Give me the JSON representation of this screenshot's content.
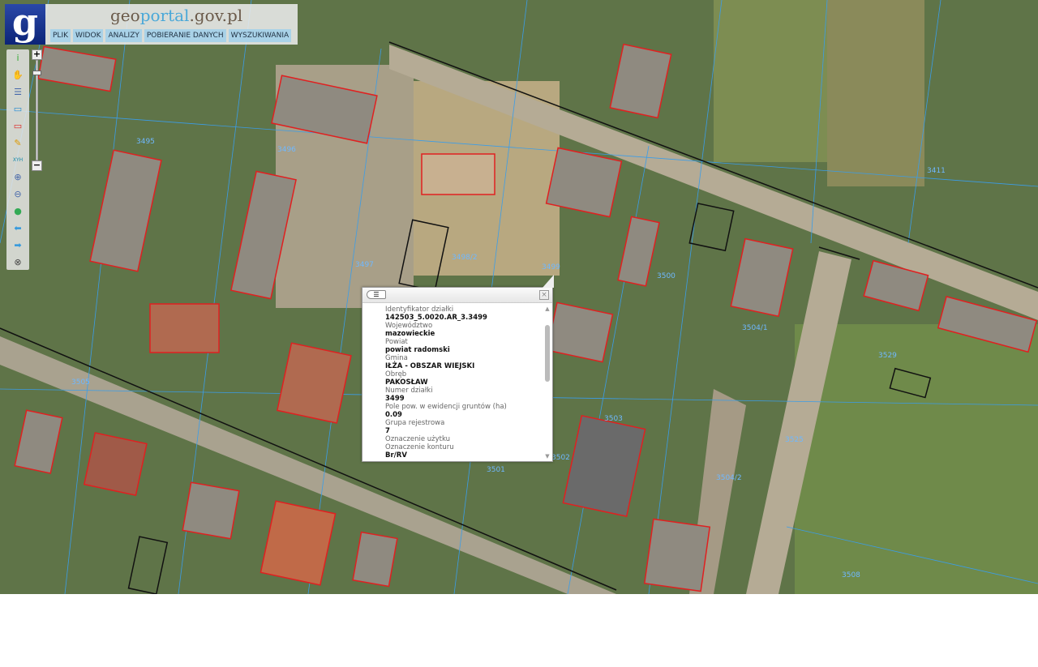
{
  "header": {
    "logo_letter": "g",
    "site_title_a": "geo",
    "site_title_b": "portal",
    "site_title_c": ".gov.pl",
    "menu": [
      "PLIK",
      "WIDOK",
      "ANALIZY",
      "POBIERANIE DANYCH",
      "WYSZUKIWANIA"
    ]
  },
  "toolbar": {
    "tools": [
      {
        "name": "info-icon",
        "glyph": "i",
        "color": "#3a3"
      },
      {
        "name": "pan-hand-icon",
        "glyph": "✋",
        "color": "#c96"
      },
      {
        "name": "legend-icon",
        "glyph": "☰",
        "color": "#46a"
      },
      {
        "name": "select-blue-icon",
        "glyph": "▭",
        "color": "#28c"
      },
      {
        "name": "select-red-icon",
        "glyph": "▭",
        "color": "#d22"
      },
      {
        "name": "pencil-icon",
        "glyph": "✎",
        "color": "#d90"
      },
      {
        "name": "xyh-icon",
        "glyph": "XYH",
        "color": "#18a"
      },
      {
        "name": "zoom-in-icon",
        "glyph": "⊕",
        "color": "#46a"
      },
      {
        "name": "zoom-out-icon",
        "glyph": "⊖",
        "color": "#46a"
      },
      {
        "name": "globe-icon",
        "glyph": "●",
        "color": "#3a5"
      },
      {
        "name": "back-arrow-icon",
        "glyph": "⬅",
        "color": "#39d"
      },
      {
        "name": "forward-arrow-icon",
        "glyph": "➡",
        "color": "#39d"
      },
      {
        "name": "full-extent-icon",
        "glyph": "⊗",
        "color": "#444"
      }
    ],
    "zoom_in": "+",
    "zoom_out": "−",
    "zoom_level": 0.1
  },
  "map": {
    "parcel_labels": [
      "3495",
      "3496",
      "3497",
      "3498/2",
      "3499",
      "3500",
      "3501",
      "3502",
      "3503",
      "3504/1",
      "3504/2",
      "3505",
      "3525",
      "3529",
      "3411",
      "3508"
    ]
  },
  "popup": {
    "back": "☰",
    "close": "×",
    "fields": [
      {
        "label": "Identyfikator działki",
        "value": "142503_5.0020.AR_3.3499"
      },
      {
        "label": "Województwo",
        "value": "mazowieckie"
      },
      {
        "label": "Powiat",
        "value": "powiat radomski"
      },
      {
        "label": "Gmina",
        "value": "IŁŻA - OBSZAR WIEJSKI"
      },
      {
        "label": "Obręb",
        "value": "PAKOSŁAW"
      },
      {
        "label": "Numer działki",
        "value": "3499"
      },
      {
        "label": "Pole pow. w ewidencji gruntów (ha)",
        "value": "0.09"
      },
      {
        "label": "Grupa rejestrowa",
        "value": "7"
      },
      {
        "label": "Oznaczenie użytku",
        "value": ""
      },
      {
        "label": "Oznaczenie konturu",
        "value": "Br/RV"
      }
    ]
  }
}
